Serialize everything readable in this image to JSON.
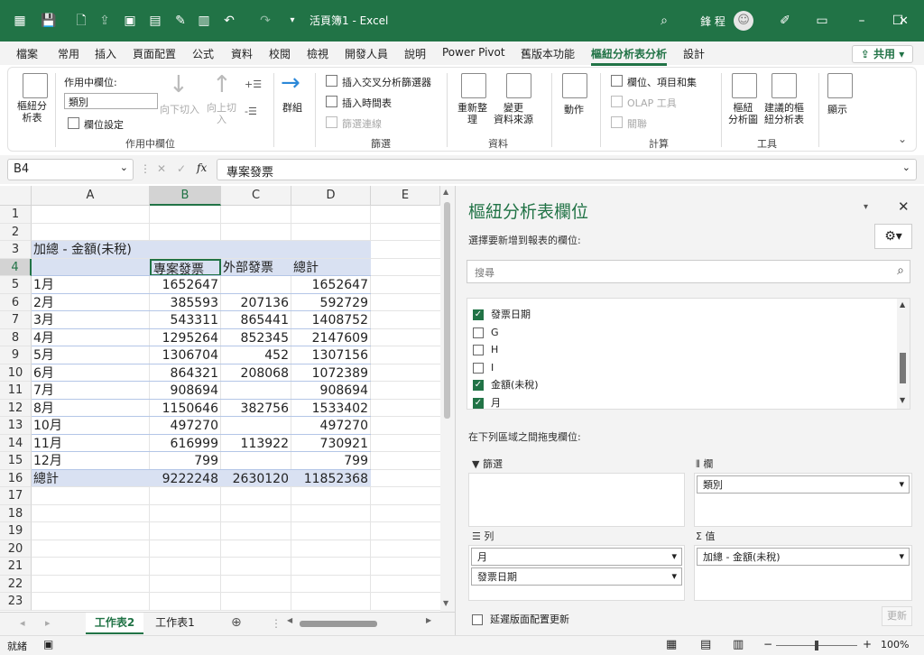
{
  "app": {
    "doc_title": "活頁簿1 - Excel",
    "user": "鋒 程"
  },
  "ribbon_tabs": [
    "檔案",
    "常用",
    "插入",
    "頁面配置",
    "公式",
    "資料",
    "校閱",
    "檢視",
    "開發人員",
    "說明",
    "Power Pivot",
    "舊版本功能",
    "樞紐分析表分析",
    "設計"
  ],
  "share_label": "共用",
  "ribbon": {
    "pivot_table": "樞紐分\n析表",
    "active_field_label": "作用中欄位:",
    "active_field_value": "類別",
    "field_settings": "欄位設定",
    "drill_down": "向下切入",
    "drill_up": "向上切\n入",
    "group_active_field": "作用中欄位",
    "group": "群組",
    "insert_slicer": "插入交叉分析篩選器",
    "insert_timeline": "插入時間表",
    "filter_connections": "篩選連線",
    "group_filter": "篩選",
    "refresh": "重新整\n理",
    "change_source": "變更\n資料來源",
    "group_data": "資料",
    "actions": "動作",
    "fields_items": "欄位、項目和集",
    "olap_tools": "OLAP 工具",
    "relationships": "關聯",
    "group_calc": "計算",
    "pivot_chart": "樞紐\n分析圖",
    "recommended": "建議的樞\n紐分析表",
    "group_tools": "工具",
    "show": "顯示"
  },
  "formula_bar": {
    "name_box": "B4",
    "content": "專案發票"
  },
  "grid": {
    "columns": [
      "A",
      "B",
      "C",
      "D",
      "E"
    ],
    "rows": [
      "1",
      "2",
      "3",
      "4",
      "5",
      "6",
      "7",
      "8",
      "9",
      "10",
      "11",
      "12",
      "13",
      "14",
      "15",
      "16",
      "17",
      "18",
      "19",
      "20",
      "21",
      "22",
      "23"
    ],
    "pivot_title": "加總 - 金額(未稅)",
    "pivot_headers": [
      "專案發票",
      "外部發票",
      "總計"
    ],
    "pivot_rows": [
      {
        "label": "1月",
        "b": "1652647",
        "c": "",
        "d": "1652647"
      },
      {
        "label": "2月",
        "b": "385593",
        "c": "207136",
        "d": "592729"
      },
      {
        "label": "3月",
        "b": "543311",
        "c": "865441",
        "d": "1408752"
      },
      {
        "label": "4月",
        "b": "1295264",
        "c": "852345",
        "d": "2147609"
      },
      {
        "label": "5月",
        "b": "1306704",
        "c": "452",
        "d": "1307156"
      },
      {
        "label": "6月",
        "b": "864321",
        "c": "208068",
        "d": "1072389"
      },
      {
        "label": "7月",
        "b": "908694",
        "c": "",
        "d": "908694"
      },
      {
        "label": "8月",
        "b": "1150646",
        "c": "382756",
        "d": "1533402"
      },
      {
        "label": "10月",
        "b": "497270",
        "c": "",
        "d": "497270"
      },
      {
        "label": "11月",
        "b": "616999",
        "c": "113922",
        "d": "730921"
      },
      {
        "label": "12月",
        "b": "799",
        "c": "",
        "d": "799"
      }
    ],
    "total_label": "總計",
    "total_b": "9222248",
    "total_c": "2630120",
    "total_d": "11852368"
  },
  "sheets": {
    "tabs": [
      "工作表2",
      "工作表1"
    ],
    "active": "工作表2"
  },
  "pane": {
    "title": "樞紐分析表欄位",
    "subtitle": "選擇要新增到報表的欄位:",
    "search_placeholder": "搜尋",
    "fields": [
      {
        "name": "發票日期",
        "checked": true
      },
      {
        "name": "G",
        "checked": false
      },
      {
        "name": "H",
        "checked": false
      },
      {
        "name": "I",
        "checked": false
      },
      {
        "name": "金額(未稅)",
        "checked": true
      },
      {
        "name": "月",
        "checked": true
      }
    ],
    "drag_label": "在下列區域之間拖曳欄位:",
    "filters_label": "篩選",
    "columns_label": "欄",
    "columns_value": "類別",
    "rows_label": "列",
    "rows_values": [
      "月",
      "發票日期"
    ],
    "values_label": "值",
    "values_value": "加總 - 金額(未稅)",
    "defer_label": "延遲版面配置更新",
    "update_label": "更新"
  },
  "status": {
    "ready": "就緒",
    "zoom": "100%"
  },
  "colors": {
    "accent": "#217346",
    "pivot_header": "#d9e1f2"
  }
}
